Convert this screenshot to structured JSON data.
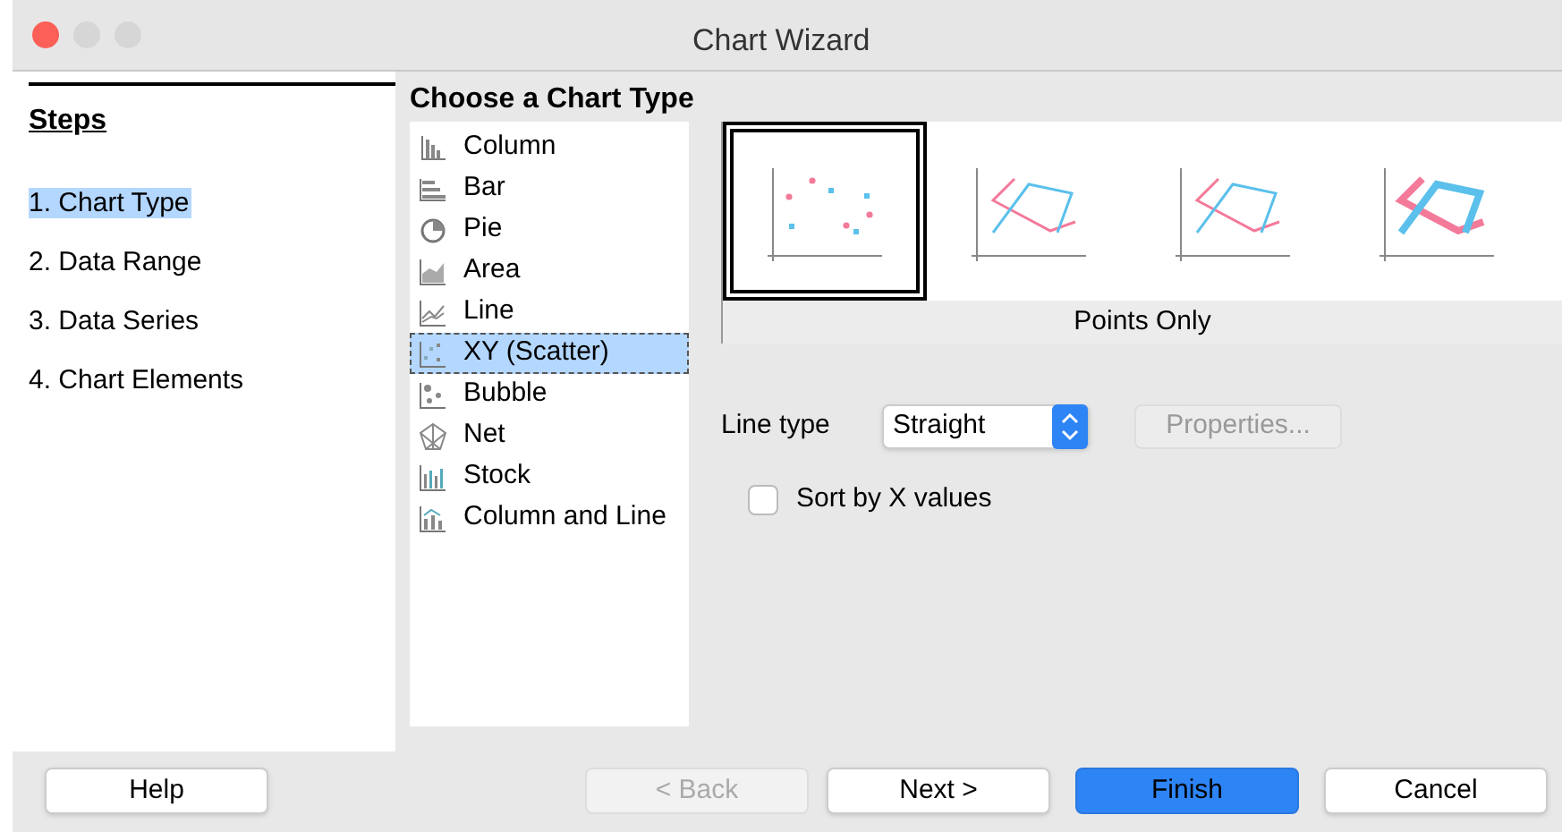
{
  "window": {
    "title": "Chart Wizard"
  },
  "steps": {
    "title": "Steps",
    "items": [
      {
        "label": "1. Chart Type",
        "selected": true
      },
      {
        "label": "2. Data Range",
        "selected": false
      },
      {
        "label": "3. Data Series",
        "selected": false
      },
      {
        "label": "4. Chart Elements",
        "selected": false
      }
    ]
  },
  "chart_types": {
    "title": "Choose a Chart Type",
    "items": [
      {
        "label": "Column",
        "selected": false
      },
      {
        "label": "Bar",
        "selected": false
      },
      {
        "label": "Pie",
        "selected": false
      },
      {
        "label": "Area",
        "selected": false
      },
      {
        "label": "Line",
        "selected": false
      },
      {
        "label": "XY (Scatter)",
        "selected": true
      },
      {
        "label": "Bubble",
        "selected": false
      },
      {
        "label": "Net",
        "selected": false
      },
      {
        "label": "Stock",
        "selected": false
      },
      {
        "label": "Column and Line",
        "selected": false
      }
    ]
  },
  "variants": {
    "items": [
      {
        "selected": true
      },
      {
        "selected": false
      },
      {
        "selected": false
      },
      {
        "selected": false
      }
    ],
    "caption": "Points Only"
  },
  "line_type": {
    "label": "Line type",
    "value": "Straight"
  },
  "properties_button": {
    "label": "Properties...",
    "disabled": true
  },
  "sort_by_x": {
    "label": "Sort by X values",
    "checked": false
  },
  "buttons": [
    {
      "label": "Help",
      "kind": "normal",
      "disabled": false
    },
    {
      "label": "< Back",
      "kind": "normal",
      "disabled": true
    },
    {
      "label": "Next >",
      "kind": "normal",
      "disabled": false
    },
    {
      "label": "Finish",
      "kind": "primary",
      "disabled": false
    },
    {
      "label": "Cancel",
      "kind": "normal",
      "disabled": false
    }
  ]
}
